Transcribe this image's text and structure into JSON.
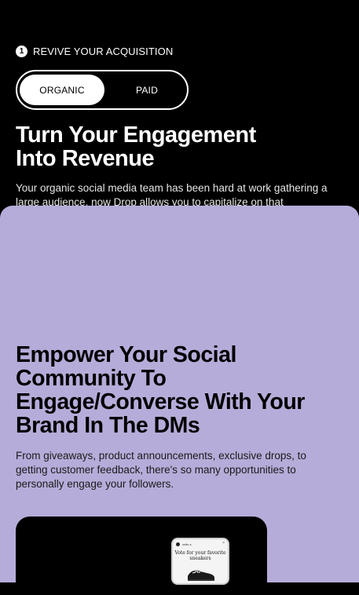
{
  "section": {
    "step_number": "1",
    "step_label": "REVIVE YOUR ACQUISITION",
    "toggle": {
      "options": [
        "ORGANIC",
        "PAID"
      ],
      "selected": "ORGANIC"
    },
    "headline": "Turn Your Engagement Into Revenue",
    "body": "Your organic social media team has been hard at work gathering a large audience, now Drop allows you to capitalize on that"
  },
  "feature_card": {
    "background": "#b6acd9",
    "headline": "Empower Your Social Community To Engage/Converse With Your Brand In The DMs",
    "body": "From giveaways, product announcements, exclusive drops, to getting customer feedback, there's so many opportunities to personally engage your followers.",
    "preview": {
      "handle": "nelle.s",
      "close_glyph": "×",
      "story_text": "Vote for your favorite sneakers",
      "icons": [
        "avatar-icon",
        "close-icon",
        "sneaker-icon"
      ]
    }
  }
}
